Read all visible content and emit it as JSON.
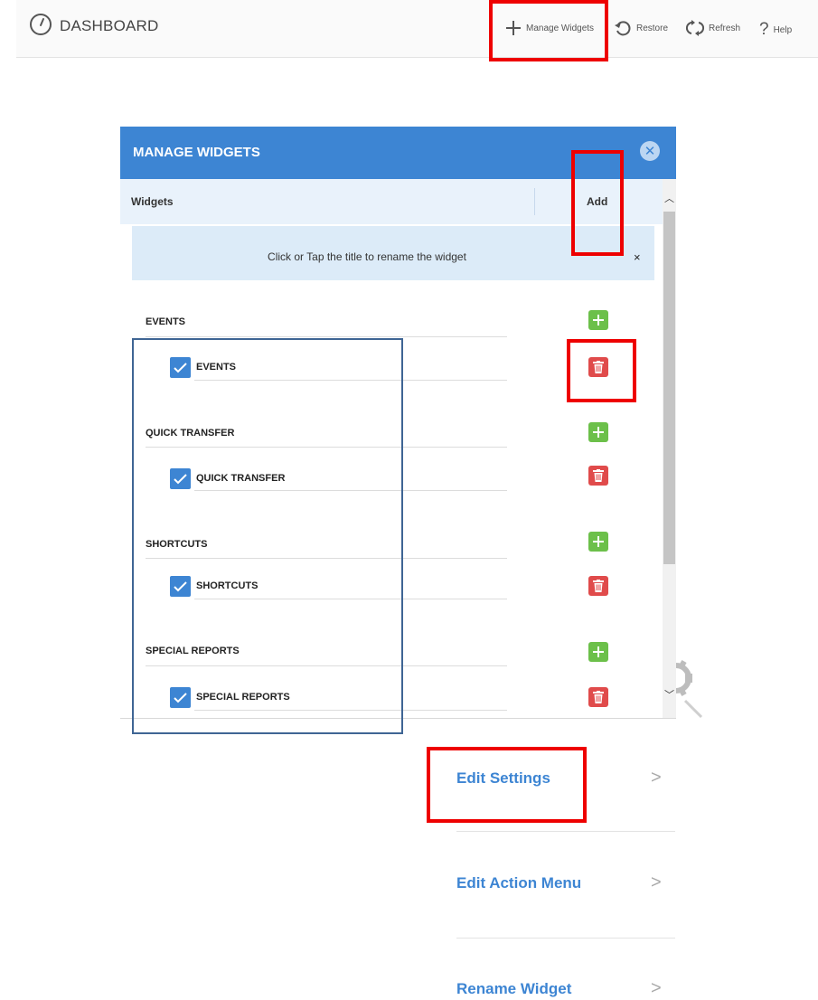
{
  "topbar": {
    "title": "DASHBOARD",
    "logo_icon": "gauge-icon",
    "actions": [
      {
        "label": "Manage Widgets",
        "icon": "plus-icon"
      },
      {
        "label": "Restore",
        "icon": "restore-icon"
      },
      {
        "label": "Refresh",
        "icon": "refresh-icon"
      },
      {
        "label": "Help",
        "icon": "question-icon"
      }
    ]
  },
  "modal": {
    "title": "MANAGE WIDGETS",
    "close_icon": "close-circle-icon",
    "columns": {
      "widgets": "Widgets",
      "add": "Add"
    },
    "info_text": "Click or Tap the title to rename the widget",
    "info_close": "×",
    "groups": [
      {
        "title": "EVENTS",
        "child": "EVENTS",
        "checked": true
      },
      {
        "title": "QUICK TRANSFER",
        "child": "QUICK TRANSFER",
        "checked": true
      },
      {
        "title": "SHORTCUTS",
        "child": "SHORTCUTS",
        "checked": true
      },
      {
        "title": "SPECIAL REPORTS",
        "child": "SPECIAL REPORTS",
        "checked": true
      }
    ]
  },
  "menu": [
    {
      "label": "Edit Settings",
      "arrow": ">"
    },
    {
      "label": "Edit Action Menu",
      "arrow": ">"
    },
    {
      "label": "Rename Widget",
      "arrow": ">"
    }
  ],
  "colors": {
    "accent": "#3d85d3",
    "add_green": "#6cc04a",
    "delete_red": "#e04b4b",
    "highlight_red": "#ee0000",
    "selection_border": "#3f6594"
  }
}
